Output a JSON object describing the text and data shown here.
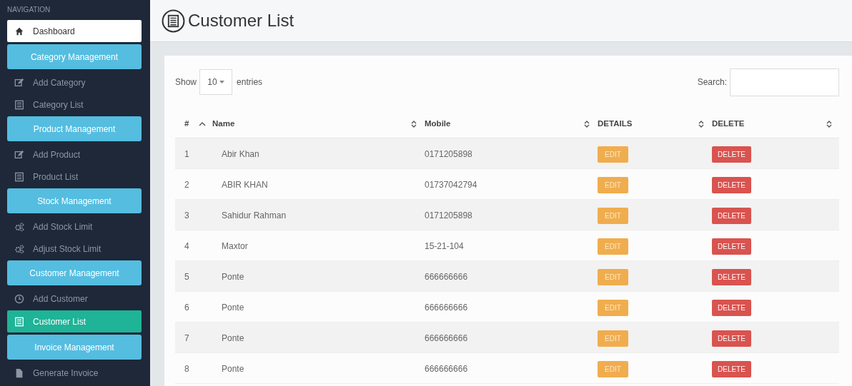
{
  "sidebar": {
    "heading": "NAVIGATION",
    "items": [
      {
        "kind": "home",
        "label": "Dashboard",
        "selected": false
      },
      {
        "kind": "section",
        "label": "Category Management"
      },
      {
        "kind": "link",
        "label": "Add Category",
        "selected": false
      },
      {
        "kind": "link",
        "label": "Category List",
        "selected": false
      },
      {
        "kind": "section",
        "label": "Product Management"
      },
      {
        "kind": "link",
        "label": "Add Product",
        "selected": false
      },
      {
        "kind": "link",
        "label": "Product List",
        "selected": false
      },
      {
        "kind": "section",
        "label": "Stock Management"
      },
      {
        "kind": "link",
        "label": "Add Stock Limit",
        "selected": false
      },
      {
        "kind": "link",
        "label": "Adjust Stock Limit",
        "selected": false
      },
      {
        "kind": "section",
        "label": "Customer Management"
      },
      {
        "kind": "link",
        "label": "Add Customer",
        "selected": false
      },
      {
        "kind": "link",
        "label": "Customer List",
        "selected": true
      },
      {
        "kind": "section",
        "label": "Invoice Management"
      },
      {
        "kind": "link",
        "label": "Generate Invoice",
        "selected": false
      }
    ]
  },
  "page": {
    "title": "Customer List"
  },
  "table_controls": {
    "show_label": "Show",
    "page_size": "10",
    "entries_label": "entries",
    "search_label": "Search:"
  },
  "table": {
    "columns": [
      {
        "label": "#",
        "sorted": true
      },
      {
        "label": "Name",
        "sorted": false
      },
      {
        "label": "Mobile",
        "sorted": false
      },
      {
        "label": "DETAILS",
        "sorted": false
      },
      {
        "label": "DELETE",
        "sorted": false
      }
    ],
    "rows": [
      {
        "index": "1",
        "name": "Abir Khan",
        "mobile": "0171205898",
        "edit": "EDIT",
        "delete": "DELETE"
      },
      {
        "index": "2",
        "name": "ABIR KHAN",
        "mobile": "01737042794",
        "edit": "EDIT",
        "delete": "DELETE"
      },
      {
        "index": "3",
        "name": "Sahidur Rahman",
        "mobile": "0171205898",
        "edit": "EDIT",
        "delete": "DELETE"
      },
      {
        "index": "4",
        "name": "Maxtor",
        "mobile": "15-21-104",
        "edit": "EDIT",
        "delete": "DELETE"
      },
      {
        "index": "5",
        "name": "Ponte",
        "mobile": "666666666",
        "edit": "EDIT",
        "delete": "DELETE"
      },
      {
        "index": "6",
        "name": "Ponte",
        "mobile": "666666666",
        "edit": "EDIT",
        "delete": "DELETE"
      },
      {
        "index": "7",
        "name": "Ponte",
        "mobile": "666666666",
        "edit": "EDIT",
        "delete": "DELETE"
      },
      {
        "index": "8",
        "name": "Ponte",
        "mobile": "666666666",
        "edit": "EDIT",
        "delete": "DELETE"
      }
    ]
  }
}
